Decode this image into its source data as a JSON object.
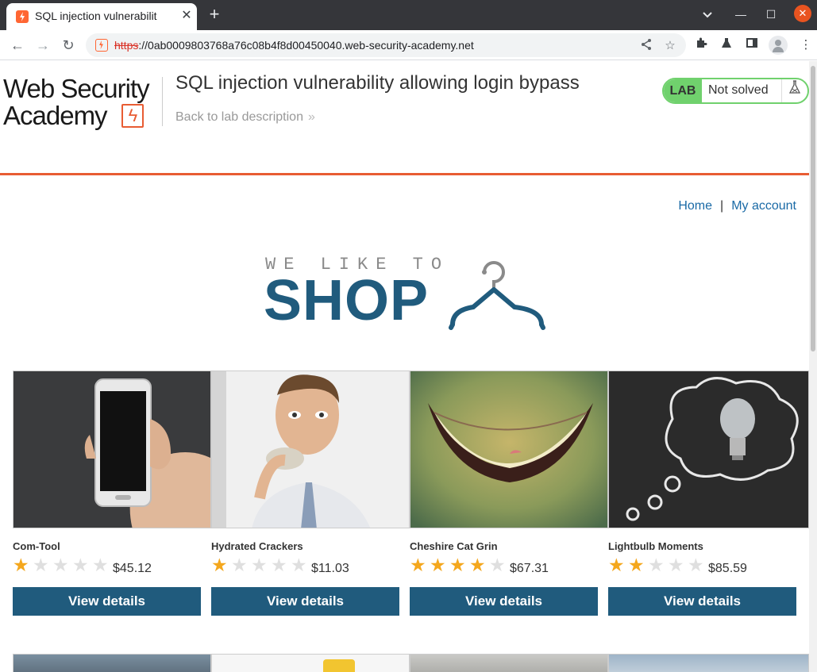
{
  "browser": {
    "tab_title": "SQL injection vulnerabilit",
    "tab_close": "✕",
    "new_tab": "+",
    "url_scheme": "https",
    "url_rest": "://0ab0009803768a76c08b4f8d00450040.web-security-academy.net",
    "controls": {
      "minimize": "—",
      "maximize": "☐",
      "close": "✕"
    },
    "nav": {
      "back": "←",
      "forward": "→",
      "reload": "↻"
    },
    "actions": {
      "share": "⋖",
      "bookmark": "☆",
      "extensions": "⧉",
      "labs": "▲",
      "sidepanel": "◨",
      "menu": "⋮"
    }
  },
  "header": {
    "logo_line1": "Web Security",
    "logo_line2": "Academy",
    "logo_bolt": "ϟ",
    "lab_title": "SQL injection vulnerability allowing login bypass",
    "back_link": "Back to lab description",
    "back_chevron": "»",
    "lab_badge": "LAB",
    "lab_status": "Not solved",
    "flask_icon": "⚗"
  },
  "nav_links": {
    "home": "Home",
    "separator": "|",
    "my_account": "My account"
  },
  "banner": {
    "small_text": "WE LIKE TO",
    "big_text": "SHOP"
  },
  "products": [
    {
      "name": "Com-Tool",
      "rating": 1,
      "price": "$45.12",
      "button": "View details"
    },
    {
      "name": "Hydrated Crackers",
      "rating": 1,
      "price": "$11.03",
      "button": "View details"
    },
    {
      "name": "Cheshire Cat Grin",
      "rating": 4,
      "price": "$67.31",
      "button": "View details"
    },
    {
      "name": "Lightbulb Moments",
      "rating": 2,
      "price": "$85.59",
      "button": "View details"
    }
  ],
  "colors": {
    "brand_orange": "#e85c33",
    "primary_blue": "#205b7d",
    "lab_green": "#70d16d",
    "link_blue": "#1a6aa6",
    "star_gold": "#f4a71d"
  }
}
